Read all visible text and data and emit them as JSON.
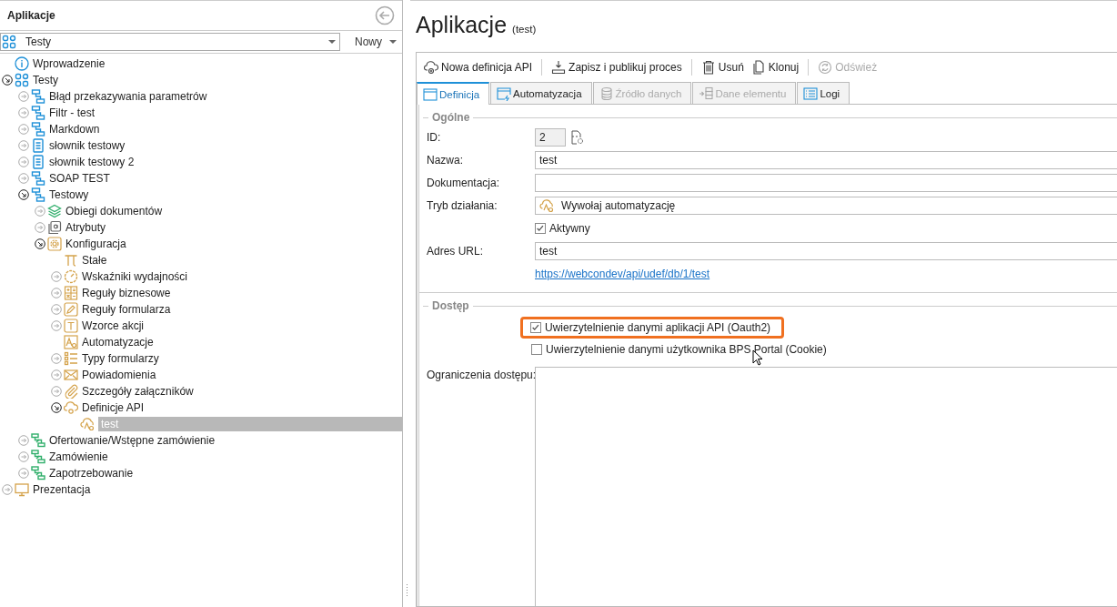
{
  "sidebar": {
    "title": "Aplikacje",
    "app_select": {
      "value": "Testy"
    },
    "new_button": "Nowy",
    "tree": [
      {
        "label": "Wprowadzenie",
        "kind": "info",
        "selected": false
      },
      {
        "label": "Testy",
        "kind": "app",
        "expanded": true,
        "selected": false,
        "children": [
          {
            "label": "Błąd przekazywania parametrów",
            "kind": "process",
            "expanded": false,
            "selected": false
          },
          {
            "label": "Filtr - test",
            "kind": "process",
            "expanded": false,
            "selected": false
          },
          {
            "label": "Markdown",
            "kind": "process",
            "expanded": false,
            "selected": false
          },
          {
            "label": "słownik testowy",
            "kind": "dictionary",
            "expanded": false,
            "selected": false
          },
          {
            "label": "słownik testowy 2",
            "kind": "dictionary",
            "expanded": false,
            "selected": false
          },
          {
            "label": "SOAP TEST",
            "kind": "process",
            "expanded": false,
            "selected": false
          },
          {
            "label": "Testowy",
            "kind": "process",
            "expanded": true,
            "selected": false,
            "children": [
              {
                "label": "Obiegi dokumentów",
                "kind": "workflows",
                "expanded": false,
                "selected": false
              },
              {
                "label": "Atrybuty",
                "kind": "attributes",
                "expanded": false,
                "selected": false
              },
              {
                "label": "Konfiguracja",
                "kind": "config",
                "expanded": true,
                "selected": false,
                "children": [
                  {
                    "label": "Stałe",
                    "kind": "constants",
                    "selected": false
                  },
                  {
                    "label": "Wskaźniki wydajności",
                    "kind": "kpi",
                    "expanded": false,
                    "selected": false
                  },
                  {
                    "label": "Reguły biznesowe",
                    "kind": "business",
                    "expanded": false,
                    "selected": false
                  },
                  {
                    "label": "Reguły formularza",
                    "kind": "formrules",
                    "expanded": false,
                    "selected": false
                  },
                  {
                    "label": "Wzorce akcji",
                    "kind": "templates",
                    "expanded": false,
                    "selected": false
                  },
                  {
                    "label": "Automatyzacje",
                    "kind": "automation",
                    "selected": false
                  },
                  {
                    "label": "Typy formularzy",
                    "kind": "formtypes",
                    "expanded": false,
                    "selected": false
                  },
                  {
                    "label": "Powiadomienia",
                    "kind": "mail",
                    "expanded": false,
                    "selected": false
                  },
                  {
                    "label": "Szczegóły załączników",
                    "kind": "attachment",
                    "expanded": false,
                    "selected": false
                  },
                  {
                    "label": "Definicje API",
                    "kind": "apidefs",
                    "expanded": true,
                    "selected": false,
                    "children": [
                      {
                        "label": "test",
                        "kind": "api",
                        "selected": true
                      }
                    ]
                  }
                ]
              }
            ]
          },
          {
            "label": "Ofertowanie/Wstępne zamówienie",
            "kind": "flow",
            "expanded": false,
            "selected": false
          },
          {
            "label": "Zamówienie",
            "kind": "flow",
            "expanded": false,
            "selected": false
          },
          {
            "label": "Zapotrzebowanie",
            "kind": "flow",
            "expanded": false,
            "selected": false
          }
        ]
      },
      {
        "label": "Prezentacja",
        "kind": "presentation",
        "expanded": false,
        "selected": false
      }
    ]
  },
  "main": {
    "title": "Aplikacje",
    "subtitle": "(test)",
    "toolbar": [
      {
        "label": "Nowa definicja API",
        "kind": "new",
        "disabled": false,
        "separator_after": true
      },
      {
        "label": "Zapisz i publikuj proces",
        "kind": "save",
        "disabled": false,
        "separator_after": true
      },
      {
        "label": "Usuń",
        "kind": "delete",
        "disabled": false,
        "separator_after": false
      },
      {
        "label": "Klonuj",
        "kind": "clone",
        "disabled": false,
        "separator_after": true
      },
      {
        "label": "Odśwież",
        "kind": "refresh",
        "disabled": true,
        "separator_after": false
      }
    ],
    "tabs": [
      {
        "label": "Definicja",
        "kind": "window",
        "selected": true,
        "disabled": false
      },
      {
        "label": "Automatyzacja",
        "kind": "auto",
        "selected": false,
        "disabled": false
      },
      {
        "label": "Źródło danych",
        "kind": "db",
        "selected": false,
        "disabled": true
      },
      {
        "label": "Dane elementu",
        "kind": "data",
        "selected": false,
        "disabled": true
      },
      {
        "label": "Logi",
        "kind": "logs",
        "selected": false,
        "disabled": false
      }
    ],
    "general": {
      "title": "Ogólne",
      "id": {
        "label": "ID:",
        "value": "2"
      },
      "name": {
        "label": "Nazwa:",
        "value": "test"
      },
      "documentation": {
        "label": "Dokumentacja:"
      },
      "mode": {
        "label": "Tryb działania:",
        "value": "Wywołaj automatyzację"
      },
      "active": {
        "label": "Aktywny",
        "checked": true
      },
      "url": {
        "label": "Adres URL:",
        "value": "test"
      },
      "link": "https://webcondev/api/udef/db/1/test"
    },
    "access": {
      "title": "Dostęp",
      "options": [
        {
          "label": "Uwierzytelnienie danymi aplikacji API (Oauth2)",
          "checked": true,
          "highlighted": true
        },
        {
          "label": "Uwierzytelnienie danymi użytkownika BPS Portal (Cookie)",
          "checked": false,
          "highlighted": false
        }
      ],
      "restrictions": {
        "label": "Ograniczenia dostępu:"
      }
    }
  }
}
